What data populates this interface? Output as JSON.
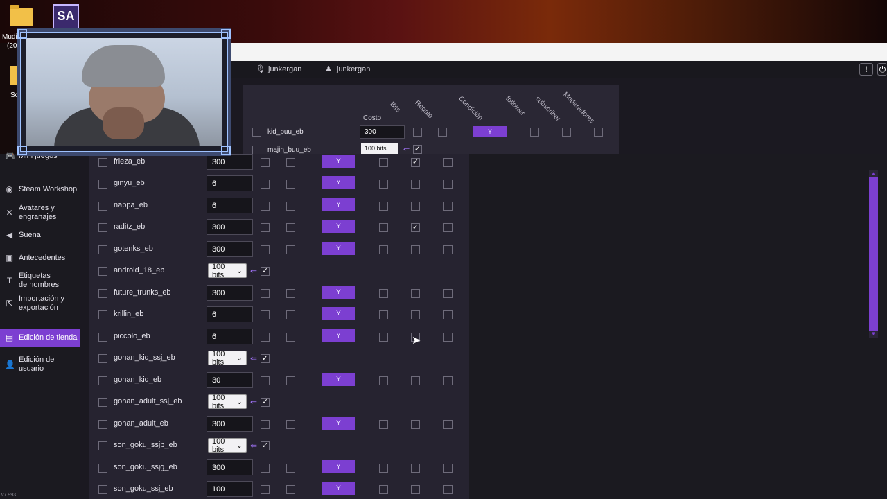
{
  "desktop": {
    "labels": [
      "Mudi",
      "(20",
      "Sc"
    ],
    "app_badge": "SA"
  },
  "header": {
    "user_mic": "junkergan",
    "user_bot": "junkergan",
    "alert_icon": "!"
  },
  "columns": {
    "costo": "Costo",
    "rotated": [
      "Bits",
      "Regalo",
      "Condición",
      "follower",
      "subscriber",
      "Moderadores"
    ]
  },
  "top_rows": [
    {
      "name": "kid_buu_eb",
      "cost": "300",
      "type": "input",
      "y_label": "Y"
    },
    {
      "name": "majin_buu_eb",
      "cost": "100 bits",
      "type": "bits"
    }
  ],
  "sidebar": {
    "items": [
      {
        "label": "Mini juegos",
        "icon": "gamepad-icon"
      },
      {
        "label": "Steam Workshop",
        "icon": "steam-icon"
      },
      {
        "label": "Avatares y engranajes",
        "icon": "avatar-icon"
      },
      {
        "label": "Suena",
        "icon": "speaker-icon"
      },
      {
        "label": "Antecedentes",
        "icon": "image-icon"
      },
      {
        "label": "Etiquetas de nombres",
        "icon": "text-icon"
      },
      {
        "label": "Importación y exportación",
        "icon": "export-icon"
      },
      {
        "label": "Edición de tienda",
        "icon": "store-icon"
      },
      {
        "label": "Edición de usuario",
        "icon": "user-icon"
      }
    ],
    "version": "v7.993"
  },
  "rows": [
    {
      "name": "frieza_eb",
      "cost": "300",
      "type": "input",
      "y": "Y",
      "regalo": true
    },
    {
      "name": "ginyu_eb",
      "cost": "6",
      "type": "input",
      "y": "Y",
      "regalo": false
    },
    {
      "name": "nappa_eb",
      "cost": "6",
      "type": "input",
      "y": "Y",
      "regalo": false
    },
    {
      "name": "raditz_eb",
      "cost": "300",
      "type": "input",
      "y": "Y",
      "regalo": true
    },
    {
      "name": "gotenks_eb",
      "cost": "300",
      "type": "input",
      "y": "Y",
      "regalo": false
    },
    {
      "name": "android_18_eb",
      "cost": "100 bits",
      "type": "bits"
    },
    {
      "name": "future_trunks_eb",
      "cost": "300",
      "type": "input",
      "y": "Y",
      "regalo": false
    },
    {
      "name": "krillin_eb",
      "cost": "6",
      "type": "input",
      "y": "Y",
      "regalo": false
    },
    {
      "name": "piccolo_eb",
      "cost": "6",
      "type": "input",
      "y": "Y",
      "regalo": false
    },
    {
      "name": "gohan_kid_ssj_eb",
      "cost": "100 bits",
      "type": "bits"
    },
    {
      "name": "gohan_kid_eb",
      "cost": "30",
      "type": "input",
      "y": "Y",
      "regalo": false
    },
    {
      "name": "gohan_adult_ssj_eb",
      "cost": "100 bits",
      "type": "bits"
    },
    {
      "name": "gohan_adult_eb",
      "cost": "300",
      "type": "input",
      "y": "Y",
      "regalo": false
    },
    {
      "name": "son_goku_ssjb_eb",
      "cost": "100 bits",
      "type": "bits"
    },
    {
      "name": "son_goku_ssjg_eb",
      "cost": "300",
      "type": "input",
      "y": "Y",
      "regalo": false
    },
    {
      "name": "son_goku_ssj_eb",
      "cost": "100",
      "type": "input",
      "y": "Y",
      "regalo": false
    }
  ],
  "colors": {
    "accent": "#7c3fd1",
    "panel": "#262330",
    "background": "#1b1a20"
  }
}
